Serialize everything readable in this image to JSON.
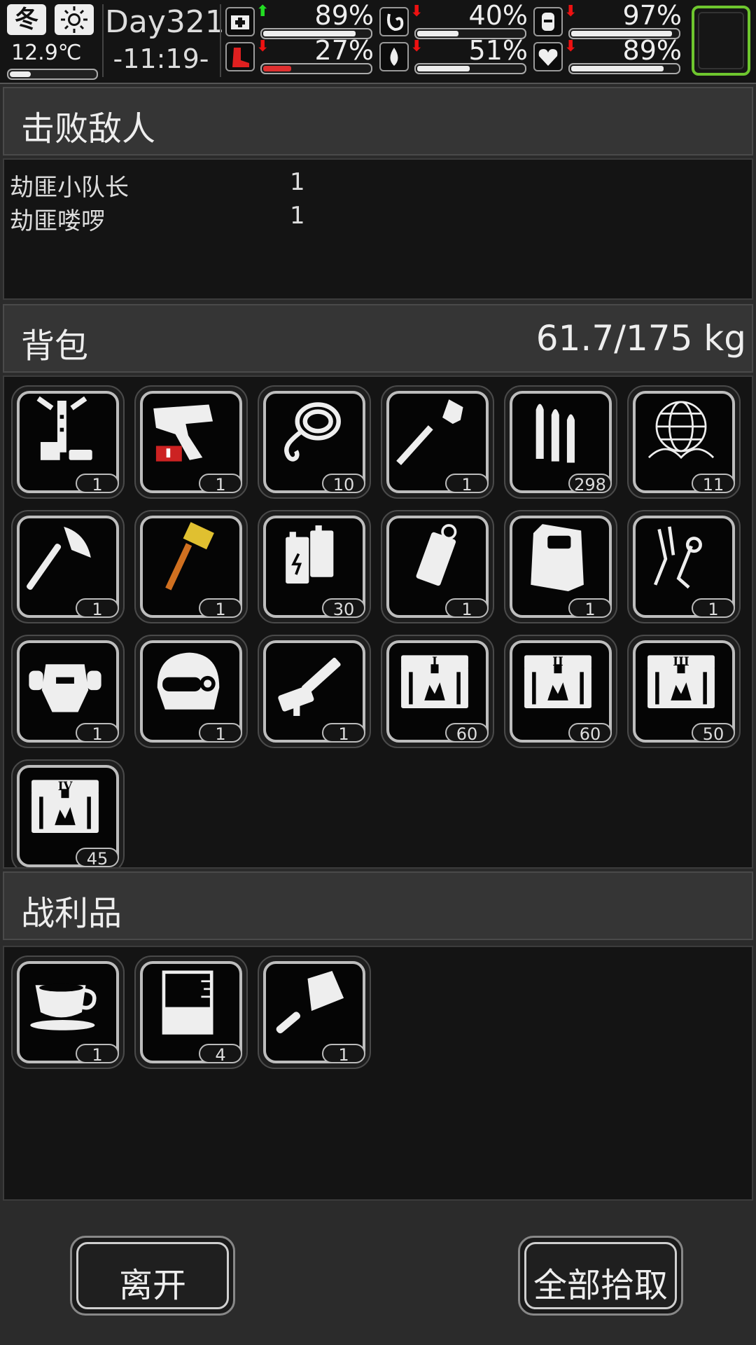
{
  "status": {
    "season": "冬",
    "weather_icon": "sun-icon",
    "temperature": "12.9℃",
    "temperature_level": 0.25,
    "day": "Day321",
    "time": "-11:19-",
    "stats": [
      {
        "name": "health",
        "icon": "medkit-icon",
        "trend": "up",
        "value": "89%",
        "level": 0.89,
        "color": "#eeeeee"
      },
      {
        "name": "hunger",
        "icon": "stomach-icon",
        "trend": "down",
        "value": "40%",
        "level": 0.4,
        "color": "#eeeeee"
      },
      {
        "name": "armor",
        "icon": "vest-icon",
        "trend": "down",
        "value": "97%",
        "level": 0.97,
        "color": "#eeeeee"
      },
      {
        "name": "stamina",
        "icon": "boot-icon",
        "trend": "down",
        "value": "27%",
        "level": 0.27,
        "color": "#e03030"
      },
      {
        "name": "thirst",
        "icon": "water-drop-icon",
        "trend": "down",
        "value": "51%",
        "level": 0.51,
        "color": "#eeeeee"
      },
      {
        "name": "mood",
        "icon": "heart-icon",
        "trend": "down",
        "value": "89%",
        "level": 0.89,
        "color": "#eeeeee"
      }
    ],
    "trend_colors": {
      "up": "#22dd22",
      "down": "#ee1111"
    }
  },
  "defeated": {
    "title": "击败敌人",
    "enemies": [
      {
        "name": "劫匪小队长",
        "count": "1"
      },
      {
        "name": "劫匪喽啰",
        "count": "1"
      }
    ]
  },
  "backpack": {
    "title": "背包",
    "weight": "61.7/175  kg",
    "items": [
      {
        "icon": "tripod-tool-icon",
        "qty": "1"
      },
      {
        "icon": "flare-gun-icon",
        "qty": "1"
      },
      {
        "icon": "rope-icon",
        "qty": "10"
      },
      {
        "icon": "shovel-icon",
        "qty": "1"
      },
      {
        "icon": "bullets-icon",
        "qty": "298"
      },
      {
        "icon": "net-icon",
        "qty": "11"
      },
      {
        "icon": "axe-icon",
        "qty": "1"
      },
      {
        "icon": "hammer-icon",
        "qty": "1"
      },
      {
        "icon": "battery-icon",
        "qty": "30"
      },
      {
        "icon": "grenade-icon",
        "qty": "1"
      },
      {
        "icon": "riot-shield-icon",
        "qty": "1"
      },
      {
        "icon": "claw-gauntlet-icon",
        "qty": "1"
      },
      {
        "icon": "mech-armor-icon",
        "qty": "1"
      },
      {
        "icon": "helmet-icon",
        "qty": "1"
      },
      {
        "icon": "minigun-icon",
        "qty": "1"
      },
      {
        "icon": "crate-i-icon",
        "qty": "60"
      },
      {
        "icon": "crate-ii-icon",
        "qty": "60"
      },
      {
        "icon": "crate-iii-icon",
        "qty": "50"
      },
      {
        "icon": "crate-iv-icon",
        "qty": "45"
      }
    ]
  },
  "loot": {
    "title": "战利品",
    "items": [
      {
        "icon": "coffee-cup-icon",
        "qty": "1"
      },
      {
        "icon": "beaker-icon",
        "qty": "4"
      },
      {
        "icon": "cleaver-icon",
        "qty": "1"
      }
    ]
  },
  "buttons": {
    "leave": "离开",
    "take_all": "全部拾取"
  },
  "colors": {
    "accent_slot": "#6ec62e",
    "background": "#2b2b2b"
  }
}
